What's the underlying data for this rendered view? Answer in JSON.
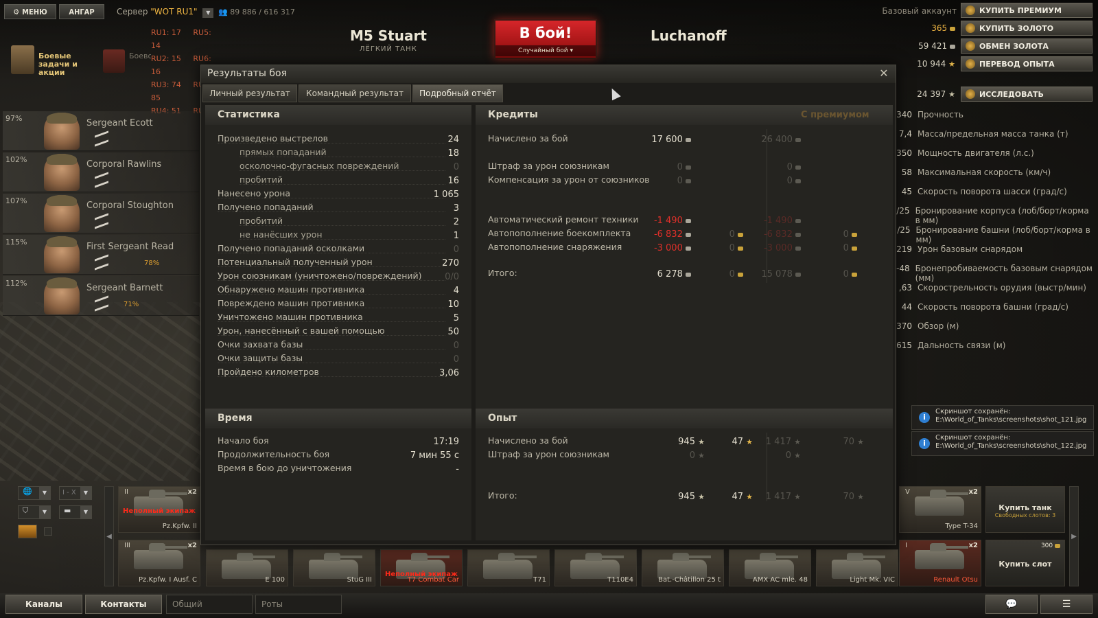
{
  "topbar": {
    "menu_label": "МЕНЮ",
    "hangar_label": "АНГАР",
    "server_prefix": "Сервер",
    "server_name": "\"WOT RU1\"",
    "online": "89 886 / 616 317",
    "servers": [
      {
        "name": "RU1:",
        "val": "17"
      },
      {
        "name": "RU5:",
        "val": "14"
      },
      {
        "name": "RU2:",
        "val": "15"
      },
      {
        "name": "RU6:",
        "val": "16"
      },
      {
        "name": "RU3:",
        "val": "74"
      },
      {
        "name": "RU7:",
        "val": "85"
      },
      {
        "name": "RU4:",
        "val": "51"
      },
      {
        "name": "RU8:",
        "val": ""
      }
    ],
    "missions_label": "Боевые задачи и акции",
    "training_label": "Боевое обучение",
    "tank_name": "M5 Stuart",
    "tank_class": "ЛЁГКИЙ ТАНК",
    "battle_button": "В бой!",
    "battle_mode": "Случайный бой",
    "player_name": "Luchanoff",
    "account_type": "Базовый аккаунт",
    "gold": "365",
    "credits": "59 421",
    "free_xp": "10 944",
    "research_xp": "24 397",
    "buy_premium": "КУПИТЬ ПРЕМИУМ",
    "buy_gold": "КУПИТЬ ЗОЛОТО",
    "exchange_gold": "ОБМЕН ЗОЛОТА",
    "transfer_xp": "ПЕРЕВОД ОПЫТА",
    "research": "ИССЛЕДОВАТЬ"
  },
  "crew": [
    {
      "pct": "97%",
      "name": "Sergeant Ecott",
      "skill": ""
    },
    {
      "pct": "102%",
      "name": "Corporal Rawlins",
      "skill": ""
    },
    {
      "pct": "107%",
      "name": "Corporal Stoughton",
      "skill": ""
    },
    {
      "pct": "115%",
      "name": "First Sergeant Read",
      "skill": "78%"
    },
    {
      "pct": "112%",
      "name": "Sergeant Barnett",
      "skill": "71%"
    }
  ],
  "tank_stats": [
    {
      "v": "340",
      "label": "Прочность"
    },
    {
      "v": "7,4",
      "label": "Масса/предельная масса танка (т)"
    },
    {
      "v": "350",
      "label": "Мощность двигателя (л.с.)"
    },
    {
      "v": "58",
      "label": "Максимальная скорость (км/ч)"
    },
    {
      "v": "45",
      "label": "Скорость поворота шасси (град/с)"
    },
    {
      "v": "/25",
      "label": "Бронирование корпуса (лоб/борт/корма в мм)"
    },
    {
      "v": "/25",
      "label": "Бронирование башни (лоб/борт/корма в мм)"
    },
    {
      "v": "219",
      "label": "Урон базовым снарядом"
    },
    {
      "v": "-48",
      "label": "Бронепробиваемость базовым снарядом (мм)"
    },
    {
      "v": ",63",
      "label": "Скорострельность орудия (выстр/мин)"
    },
    {
      "v": "44",
      "label": "Скорость поворота башни (град/с)"
    },
    {
      "v": "370",
      "label": "Обзор (м)"
    },
    {
      "v": "615",
      "label": "Дальность связи (м)"
    }
  ],
  "toasts": [
    {
      "line1": "Скриншот сохранён:",
      "line2": "E:\\World_of_Tanks\\screenshots\\shot_121.jpg"
    },
    {
      "line1": "Скриншот сохранён:",
      "line2": "E:\\World_of_Tanks\\screenshots\\shot_122.jpg"
    }
  ],
  "dialog": {
    "title": "Результаты боя",
    "tabs": [
      "Личный результат",
      "Командный результат",
      "Подробный отчёт"
    ],
    "stats_header": "Статистика",
    "stats": [
      {
        "label": "Произведено выстрелов",
        "value": "24",
        "indent": false,
        "dim": false
      },
      {
        "label": "прямых попаданий",
        "value": "18",
        "indent": true,
        "dim": false
      },
      {
        "label": "осколочно-фугасных повреждений",
        "value": "0",
        "indent": true,
        "dim": true
      },
      {
        "label": "пробитий",
        "value": "16",
        "indent": true,
        "dim": false
      },
      {
        "label": "Нанесено урона",
        "value": "1 065",
        "indent": false,
        "dim": false
      },
      {
        "label": "Получено попаданий",
        "value": "3",
        "indent": false,
        "dim": false
      },
      {
        "label": "пробитий",
        "value": "2",
        "indent": true,
        "dim": false
      },
      {
        "label": "не нанёсших урон",
        "value": "1",
        "indent": true,
        "dim": false
      },
      {
        "label": "Получено попаданий осколками",
        "value": "0",
        "indent": false,
        "dim": true
      },
      {
        "label": "Потенциальный полученный урон",
        "value": "270",
        "indent": false,
        "dim": false
      },
      {
        "label": "Урон союзникам (уничтожено/повреждений)",
        "value": "0/0",
        "indent": false,
        "dim": true
      },
      {
        "label": "Обнаружено машин противника",
        "value": "4",
        "indent": false,
        "dim": false
      },
      {
        "label": "Повреждено машин противника",
        "value": "10",
        "indent": false,
        "dim": false
      },
      {
        "label": "Уничтожено машин противника",
        "value": "5",
        "indent": false,
        "dim": false
      },
      {
        "label": "Урон, нанесённый с вашей помощью",
        "value": "50",
        "indent": false,
        "dim": false
      },
      {
        "label": "Очки захвата базы",
        "value": "0",
        "indent": false,
        "dim": true
      },
      {
        "label": "Очки защиты базы",
        "value": "0",
        "indent": false,
        "dim": true
      },
      {
        "label": "Пройдено километров",
        "value": "3,06",
        "indent": false,
        "dim": false
      }
    ],
    "credits_header": "Кредиты",
    "premium_header": "С премиумом",
    "credits": {
      "earned_label": "Начислено за бой",
      "earned": "17 600",
      "earned_prem": "26 400",
      "ally_fine_label": "Штраф за урон союзникам",
      "ally_fine": "0",
      "ally_fine_prem": "0",
      "ally_comp_label": "Компенсация за урон от союзников",
      "ally_comp": "0",
      "ally_comp_prem": "0",
      "repair_label": "Автоматический ремонт техники",
      "repair": "-1 490",
      "repair_prem": "-1 490",
      "ammo_label": "Автопополнение боекомплекта",
      "ammo": "-6 832",
      "ammo_gold": "0",
      "ammo_prem": "-6 832",
      "ammo_prem_gold": "0",
      "equip_label": "Автопополнение снаряжения",
      "equip": "-3 000",
      "equip_gold": "0",
      "equip_prem": "-3 000",
      "equip_prem_gold": "0",
      "total_label": "Итого:",
      "total": "6 278",
      "total_gold": "0",
      "total_prem": "15 078",
      "total_prem_gold": "0"
    },
    "time_header": "Время",
    "time": [
      {
        "label": "Начало боя",
        "value": "17:19"
      },
      {
        "label": "Продолжительность боя",
        "value": "7 мин 55 с"
      },
      {
        "label": "Время в бою до уничтожения",
        "value": "-"
      }
    ],
    "xp_header": "Опыт",
    "xp": {
      "earned_label": "Начислено за бой",
      "earned": "945",
      "earned_free": "47",
      "earned_prem": "1 417",
      "earned_prem_free": "70",
      "fine_label": "Штраф за урон союзникам",
      "fine": "0",
      "fine_prem": "0",
      "total_label": "Итого:",
      "total": "945",
      "total_free": "47",
      "total_prem": "1 417",
      "total_prem_free": "70"
    }
  },
  "carousel": {
    "filter_level": "I - X",
    "tanks": [
      {
        "name": "Pz.Kpfw. II",
        "tier": "II",
        "xp": "x2",
        "warn": "Неполный экипаж",
        "prem": false
      },
      {
        "name": "Pz.Kpfw. I Ausf. C",
        "tier": "III",
        "xp": "x2",
        "warn": "",
        "prem": false
      },
      {
        "name": "E 100",
        "tier": "",
        "xp": "",
        "warn": "",
        "prem": false
      },
      {
        "name": "StuG III",
        "tier": "",
        "xp": "",
        "warn": "",
        "prem": false
      },
      {
        "name": "T7 Combat Car",
        "tier": "",
        "xp": "",
        "warn": "Неполный экипаж",
        "prem": true
      },
      {
        "name": "T71",
        "tier": "",
        "xp": "",
        "warn": "",
        "prem": false
      },
      {
        "name": "T110E4",
        "tier": "",
        "xp": "",
        "warn": "",
        "prem": false
      },
      {
        "name": "Bat.-Châtillon 25 t",
        "tier": "",
        "xp": "",
        "warn": "",
        "prem": false
      },
      {
        "name": "AMX AC mle. 48",
        "tier": "",
        "xp": "",
        "warn": "",
        "prem": false
      },
      {
        "name": "Light Mk. VIC",
        "tier": "",
        "xp": "",
        "warn": "",
        "prem": false
      },
      {
        "name": "Type T-34",
        "tier": "V",
        "xp": "x2",
        "warn": "",
        "prem": false
      },
      {
        "name": "Renault Otsu",
        "tier": "I",
        "xp": "x2",
        "warn": "",
        "prem": true
      }
    ],
    "buy_tank": "Купить танк",
    "free_slots": "Свободных слотов: 3",
    "buy_slot": "Купить слот",
    "slot_price": "300"
  },
  "bottom": {
    "channels": "Каналы",
    "contacts": "Контакты",
    "general": "Общий",
    "companies": "Роты"
  }
}
